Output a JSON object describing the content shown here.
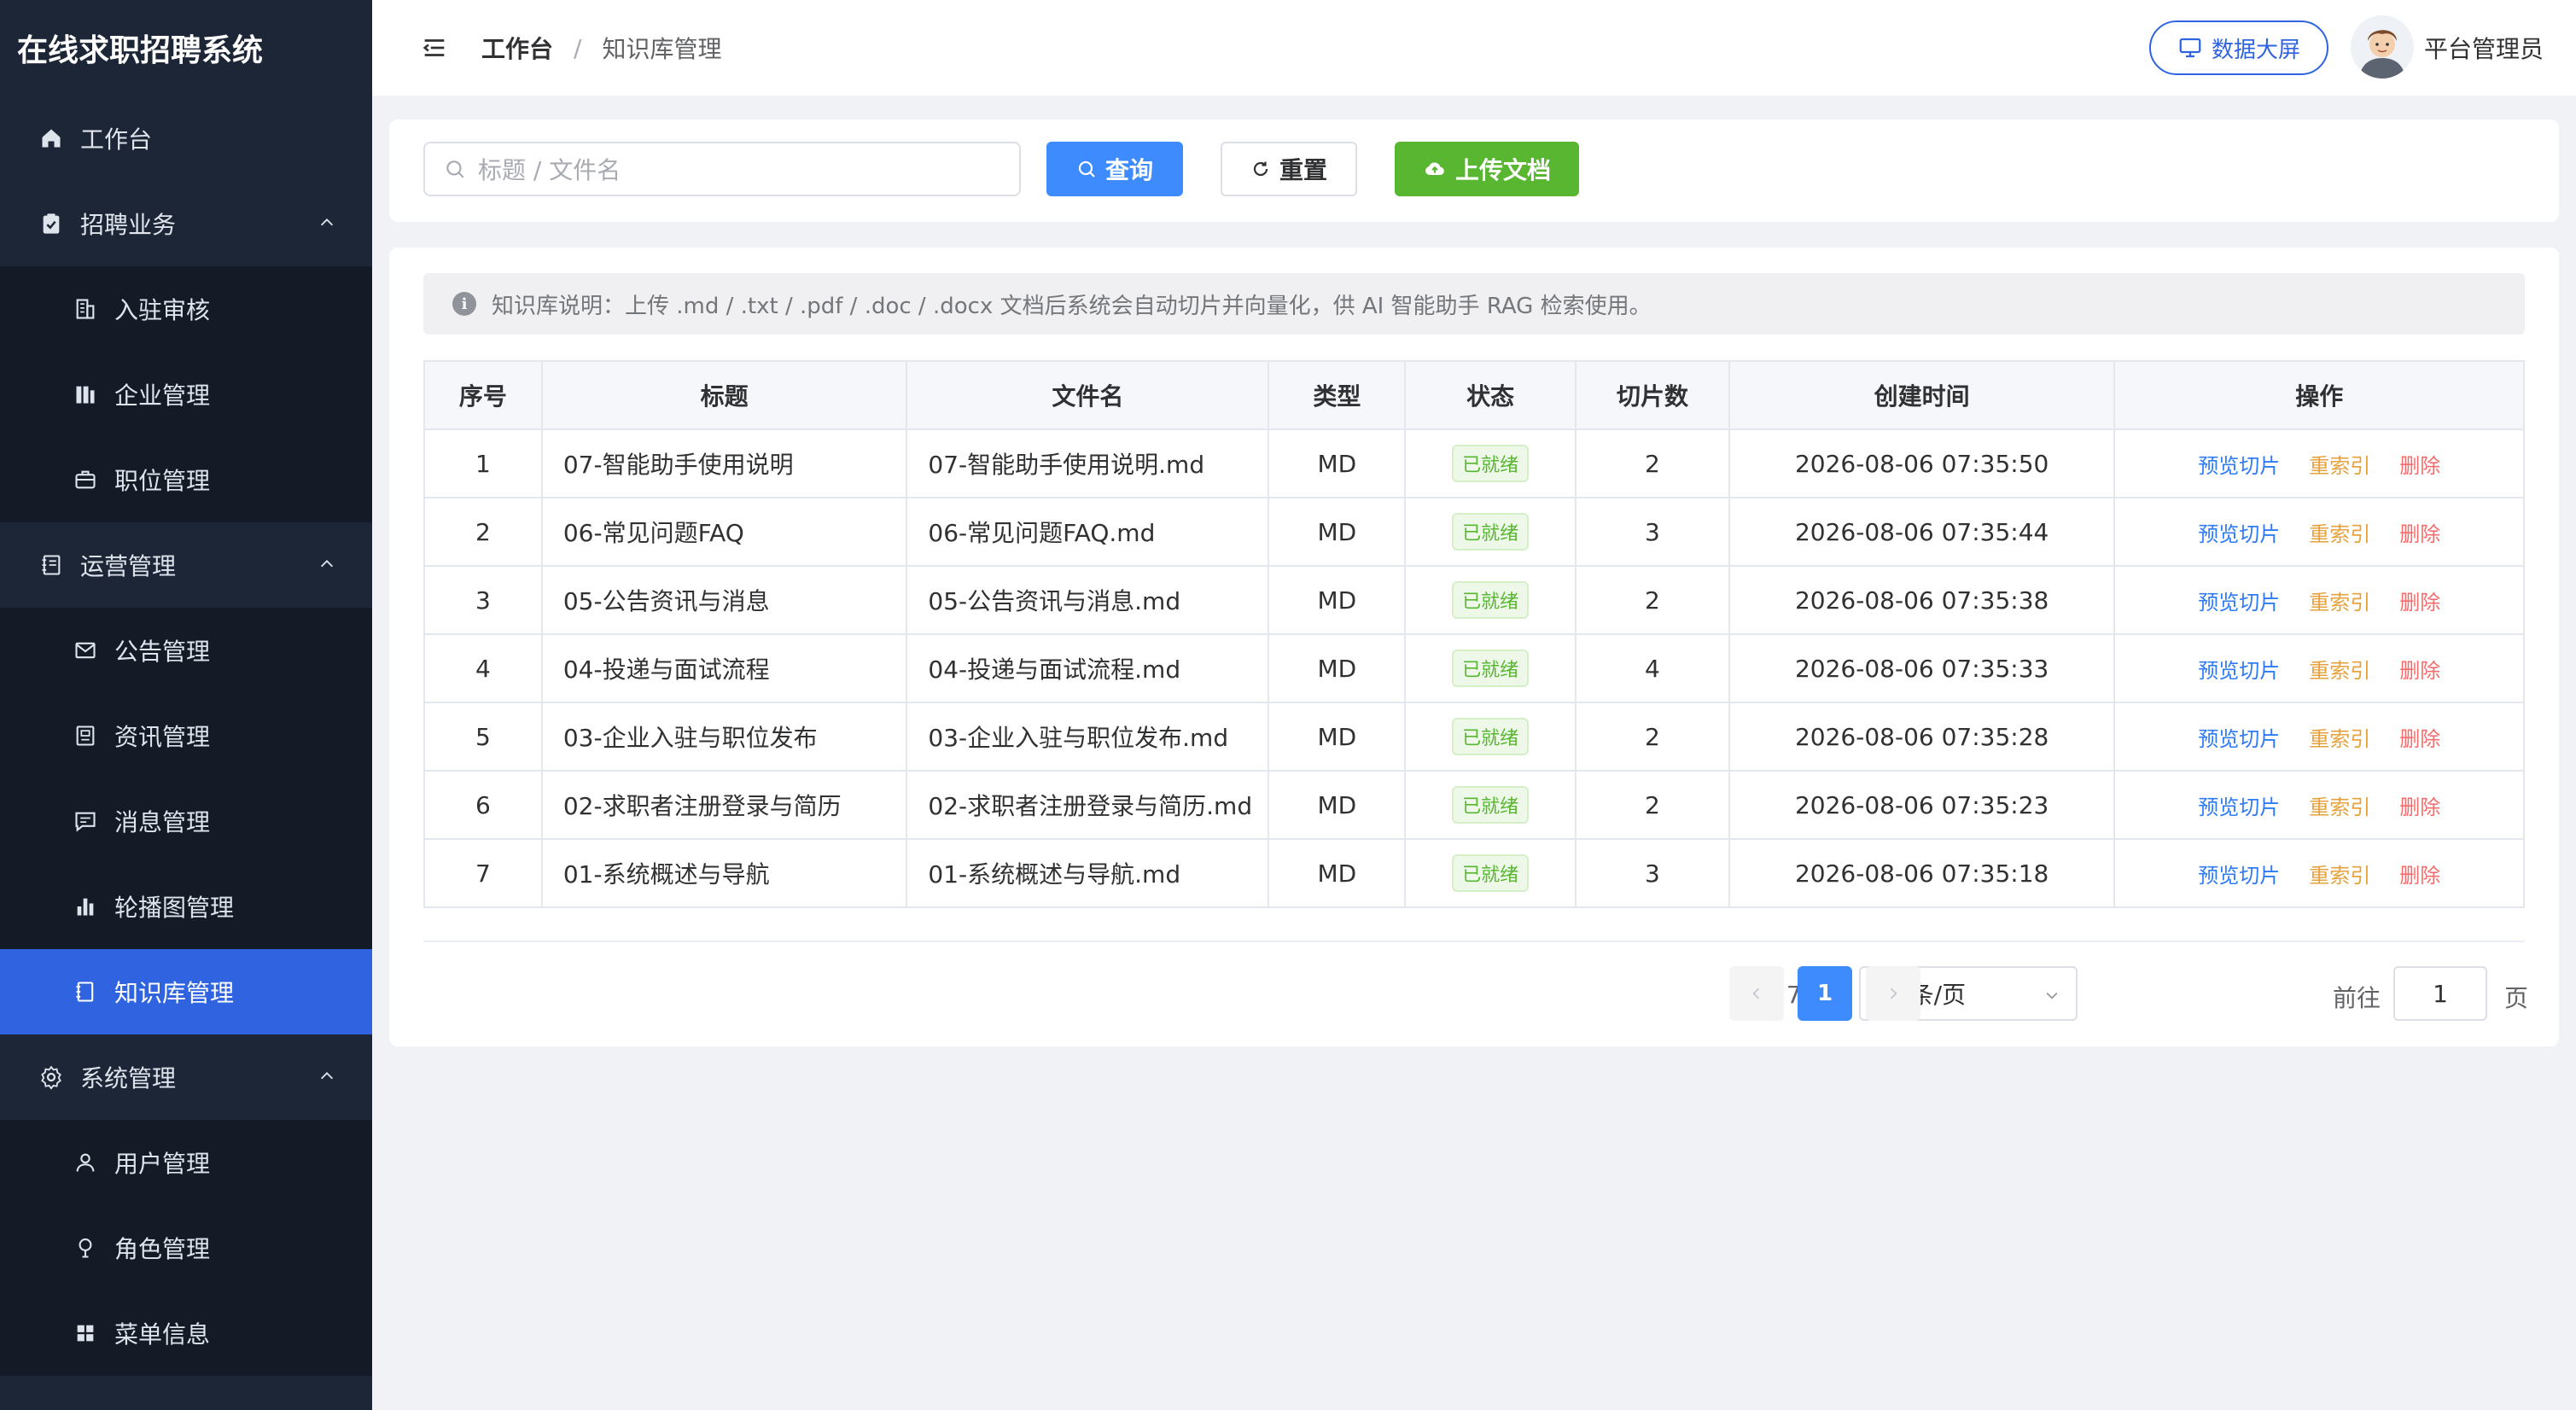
{
  "app_title": "在线求职招聘系统",
  "sidebar": {
    "items": [
      {
        "label": "工作台",
        "icon": "home-icon",
        "level": "top"
      },
      {
        "label": "招聘业务",
        "icon": "clipboard-check-icon",
        "level": "top",
        "expanded": true
      },
      {
        "label": "入驻审核",
        "icon": "building-icon",
        "level": "sub"
      },
      {
        "label": "企业管理",
        "icon": "office-icon",
        "level": "sub"
      },
      {
        "label": "职位管理",
        "icon": "briefcase-icon",
        "level": "sub"
      },
      {
        "label": "运营管理",
        "icon": "notebook-icon",
        "level": "top",
        "expanded": true
      },
      {
        "label": "公告管理",
        "icon": "mail-icon",
        "level": "sub"
      },
      {
        "label": "资讯管理",
        "icon": "news-icon",
        "level": "sub"
      },
      {
        "label": "消息管理",
        "icon": "chat-icon",
        "level": "sub"
      },
      {
        "label": "轮播图管理",
        "icon": "bar-chart-icon",
        "level": "sub"
      },
      {
        "label": "知识库管理",
        "icon": "book-icon",
        "level": "sub",
        "active": true
      },
      {
        "label": "系统管理",
        "icon": "gear-icon",
        "level": "top",
        "expanded": true
      },
      {
        "label": "用户管理",
        "icon": "user-icon",
        "level": "sub"
      },
      {
        "label": "角色管理",
        "icon": "role-icon",
        "level": "sub"
      },
      {
        "label": "菜单信息",
        "icon": "grid-icon",
        "level": "sub"
      }
    ]
  },
  "header": {
    "breadcrumb": [
      "工作台",
      "知识库管理"
    ],
    "separator": "/",
    "screen_button": "数据大屏",
    "user_name": "平台管理员"
  },
  "search": {
    "placeholder": "标题 / 文件名",
    "query_label": "查询",
    "reset_label": "重置",
    "upload_label": "上传文档"
  },
  "notice": "知识库说明：上传 .md / .txt / .pdf / .doc / .docx 文档后系统会自动切片并向量化，供 AI 智能助手 RAG 检索使用。",
  "table": {
    "columns": [
      "序号",
      "标题",
      "文件名",
      "类型",
      "状态",
      "切片数",
      "创建时间",
      "操作"
    ],
    "rows": [
      {
        "no": "1",
        "title": "07-智能助手使用说明",
        "file": "07-智能助手使用说明.md",
        "type": "MD",
        "status": "已就绪",
        "chunks": "2",
        "created": "2026-08-06 07:35:50"
      },
      {
        "no": "2",
        "title": "06-常见问题FAQ",
        "file": "06-常见问题FAQ.md",
        "type": "MD",
        "status": "已就绪",
        "chunks": "3",
        "created": "2026-08-06 07:35:44"
      },
      {
        "no": "3",
        "title": "05-公告资讯与消息",
        "file": "05-公告资讯与消息.md",
        "type": "MD",
        "status": "已就绪",
        "chunks": "2",
        "created": "2026-08-06 07:35:38"
      },
      {
        "no": "4",
        "title": "04-投递与面试流程",
        "file": "04-投递与面试流程.md",
        "type": "MD",
        "status": "已就绪",
        "chunks": "4",
        "created": "2026-08-06 07:35:33"
      },
      {
        "no": "5",
        "title": "03-企业入驻与职位发布",
        "file": "03-企业入驻与职位发布.md",
        "type": "MD",
        "status": "已就绪",
        "chunks": "2",
        "created": "2026-08-06 07:35:28"
      },
      {
        "no": "6",
        "title": "02-求职者注册登录与简历",
        "file": "02-求职者注册登录与简历.md",
        "type": "MD",
        "status": "已就绪",
        "chunks": "2",
        "created": "2026-08-06 07:35:23"
      },
      {
        "no": "7",
        "title": "01-系统概述与导航",
        "file": "01-系统概述与导航.md",
        "type": "MD",
        "status": "已就绪",
        "chunks": "3",
        "created": "2026-08-06 07:35:18"
      }
    ],
    "actions": {
      "preview": "预览切片",
      "reindex": "重索引",
      "delete": "删除"
    }
  },
  "pagination": {
    "total_text": "共 7 条",
    "page_size": "10条/页",
    "current_page": "1",
    "goto_label": "前往",
    "goto_value": "1",
    "page_suffix": "页"
  },
  "colors": {
    "sidebar_bg": "#1d2636",
    "active_bg": "#2f63e0",
    "primary": "#3d8bfd",
    "success": "#58b631",
    "warning": "#e6a23c",
    "danger": "#f56c6c"
  }
}
